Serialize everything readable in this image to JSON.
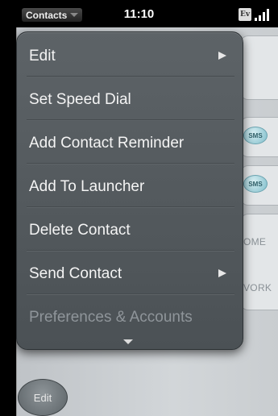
{
  "status_bar": {
    "app_name": "Contacts",
    "time": "11:10",
    "carrier_badge": "Ev"
  },
  "menu": {
    "items": [
      {
        "label": "Edit",
        "has_submenu": true,
        "enabled": true
      },
      {
        "label": "Set Speed Dial",
        "has_submenu": false,
        "enabled": true
      },
      {
        "label": "Add Contact Reminder",
        "has_submenu": false,
        "enabled": true
      },
      {
        "label": "Add To Launcher",
        "has_submenu": false,
        "enabled": true
      },
      {
        "label": "Delete Contact",
        "has_submenu": false,
        "enabled": true
      },
      {
        "label": "Send Contact",
        "has_submenu": true,
        "enabled": true
      },
      {
        "label": "Preferences & Accounts",
        "has_submenu": false,
        "enabled": false
      }
    ]
  },
  "background": {
    "sms_label": "SMS",
    "home_label": "OME",
    "work_label": "VORK",
    "edit_button_label": "Edit"
  },
  "colors": {
    "menu_bg": "#555b5f",
    "menu_text": "#f4f4f4",
    "disabled_text": "#8f959a",
    "status_bar_bg": "#000000"
  }
}
